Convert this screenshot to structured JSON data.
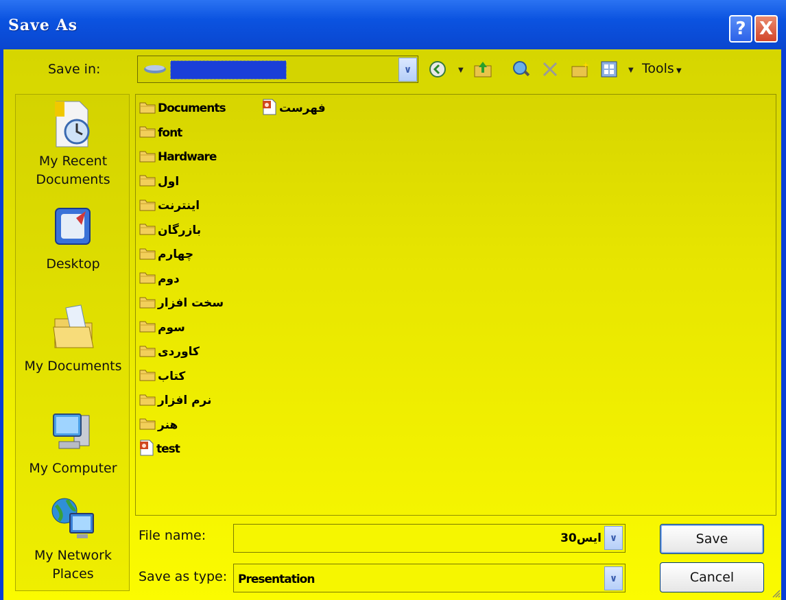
{
  "window": {
    "title": "Save As",
    "help_glyph": "?",
    "close_glyph": "X"
  },
  "toolbar": {
    "save_in_label": "Save in:",
    "tools_label": "Tools",
    "icons": [
      "drive-icon",
      "back-icon",
      "up-folder-icon",
      "search-web-icon",
      "delete-icon",
      "new-folder-icon",
      "views-icon"
    ]
  },
  "places": [
    {
      "label_lines": [
        "My Recent",
        "Documents"
      ],
      "icon": "recent-documents-icon"
    },
    {
      "label_lines": [
        "Desktop"
      ],
      "icon": "desktop-icon"
    },
    {
      "label_lines": [
        "My Documents"
      ],
      "icon": "my-documents-icon"
    },
    {
      "label_lines": [
        "My Computer"
      ],
      "icon": "my-computer-icon"
    },
    {
      "label_lines": [
        "My Network",
        "Places"
      ],
      "icon": "network-places-icon"
    }
  ],
  "files": [
    {
      "name": "Documents",
      "type": "folder"
    },
    {
      "name": "font",
      "type": "folder"
    },
    {
      "name": "Hardware",
      "type": "folder"
    },
    {
      "name": "اول",
      "type": "folder"
    },
    {
      "name": "اینترنت",
      "type": "folder"
    },
    {
      "name": "بازرگان",
      "type": "folder"
    },
    {
      "name": "چهارم",
      "type": "folder"
    },
    {
      "name": "دوم",
      "type": "folder"
    },
    {
      "name": "سخت افزار",
      "type": "folder"
    },
    {
      "name": "سوم",
      "type": "folder"
    },
    {
      "name": "کاوردی",
      "type": "folder"
    },
    {
      "name": "کتاب",
      "type": "folder"
    },
    {
      "name": "نرم افزار",
      "type": "folder"
    },
    {
      "name": "هنر",
      "type": "folder"
    },
    {
      "name": "test",
      "type": "presentation"
    },
    {
      "name": "فهرست",
      "type": "presentation"
    }
  ],
  "form": {
    "file_name_label": "File name:",
    "file_name_value": "30ایس",
    "save_type_label": "Save as type:",
    "save_type_value": "Presentation"
  },
  "buttons": {
    "save": "Save",
    "cancel": "Cancel"
  },
  "colors": {
    "title_bar": "#0a46cf",
    "background": "#f2ee00",
    "selection": "#1a3fd8"
  }
}
